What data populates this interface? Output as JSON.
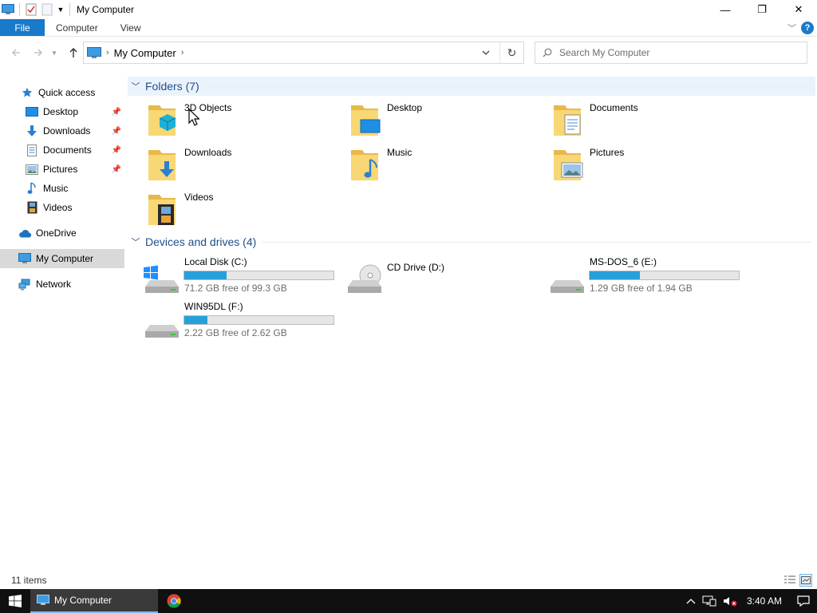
{
  "window": {
    "title": "My Computer",
    "minimize": "—",
    "restore": "❐",
    "close": "✕"
  },
  "ribbon": {
    "tabs": [
      "File",
      "Computer",
      "View"
    ]
  },
  "address": {
    "crumb": "My Computer",
    "search_placeholder": "Search My Computer"
  },
  "sidebar": {
    "quick_access": "Quick access",
    "items": [
      "Desktop",
      "Downloads",
      "Documents",
      "Pictures",
      "Music",
      "Videos"
    ],
    "onedrive": "OneDrive",
    "my_computer": "My Computer",
    "network": "Network"
  },
  "folders": {
    "header": "Folders (7)",
    "items": [
      "3D Objects",
      "Desktop",
      "Documents",
      "Downloads",
      "Music",
      "Pictures",
      "Videos"
    ]
  },
  "drives": {
    "header": "Devices and drives (4)",
    "items": [
      {
        "name": "Local Disk (C:)",
        "free": "71.2 GB free of 99.3 GB",
        "used_fraction": 0.283
      },
      {
        "name": "CD Drive (D:)",
        "free": "",
        "used_fraction": null
      },
      {
        "name": "MS-DOS_6 (E:)",
        "free": "1.29 GB free of 1.94 GB",
        "used_fraction": 0.335
      },
      {
        "name": "WIN95DL (F:)",
        "free": "2.22 GB free of 2.62 GB",
        "used_fraction": 0.153
      }
    ]
  },
  "status": {
    "count": "11 items"
  },
  "taskbar": {
    "app": "My Computer",
    "clock": "3:40 AM"
  },
  "colors": {
    "accent": "#1979ca",
    "drive_fill": "#26a0da",
    "group_header": "#1e4e8c"
  }
}
